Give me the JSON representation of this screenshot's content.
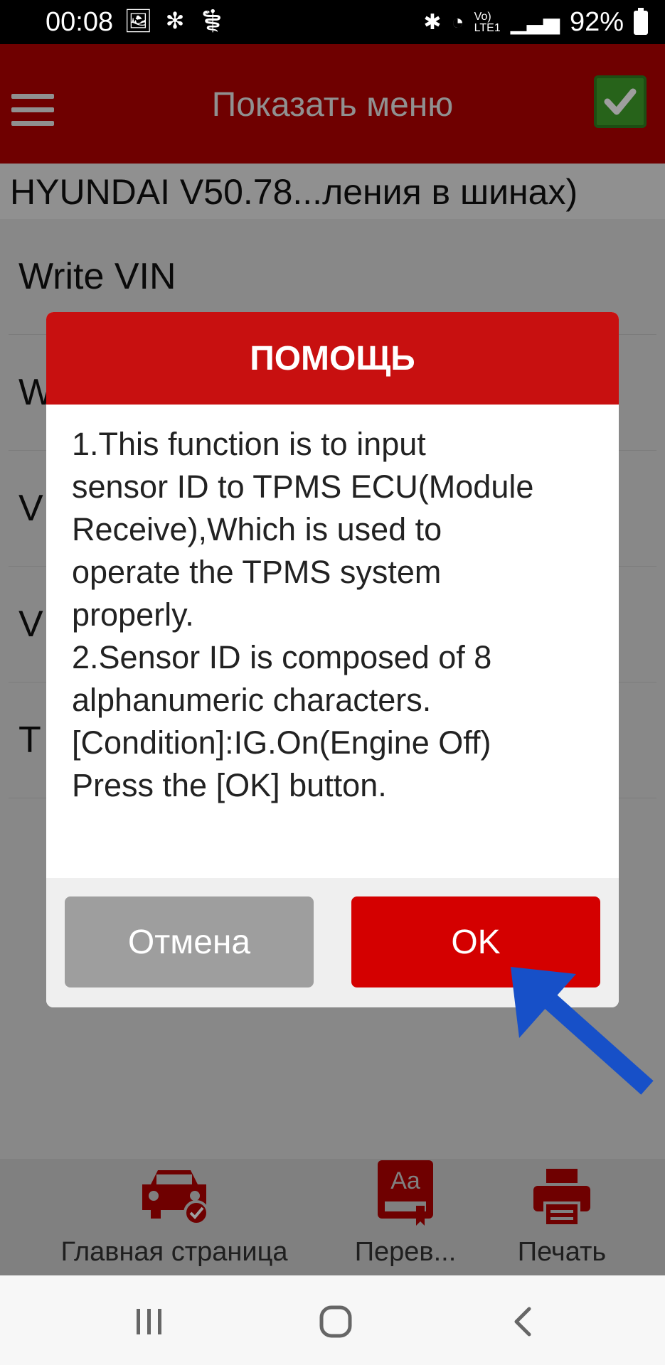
{
  "status_bar": {
    "time": "00:08",
    "battery": "92%",
    "icons_left": [
      "image-icon",
      "fan-icon",
      "stethoscope-icon"
    ],
    "icons_right": [
      "bluetooth-icon",
      "wifi-icon",
      "volte-icon",
      "signal-icon",
      "battery-icon"
    ]
  },
  "appbar": {
    "title": "Показать меню"
  },
  "path_text": "HYUNDAI V50.78...ления в шинах)",
  "list": [
    {
      "label": "Write VIN"
    },
    {
      "label": "W"
    },
    {
      "label": "V"
    },
    {
      "label": "V"
    },
    {
      "label": "T"
    }
  ],
  "dialog": {
    "title": "ПОМОЩЬ",
    "body": "1.This function is to input\nsensor ID to TPMS ECU(Module\nReceive),Which is used to\noperate the TPMS system\nproperly.\n2.Sensor ID is composed of 8\nalphanumeric characters.\n[Condition]:IG.On(Engine Off)\nPress the [OK] button.",
    "cancel_label": "Отмена",
    "ok_label": "OK"
  },
  "toolbar": {
    "home_label": "Главная страница",
    "translate_label": "Перев...",
    "print_label": "Печать"
  },
  "colors": {
    "brand_red": "#b30000",
    "ok_red": "#d40000",
    "confirm_green": "#3fa12a",
    "arrow_blue": "#1750c8"
  }
}
